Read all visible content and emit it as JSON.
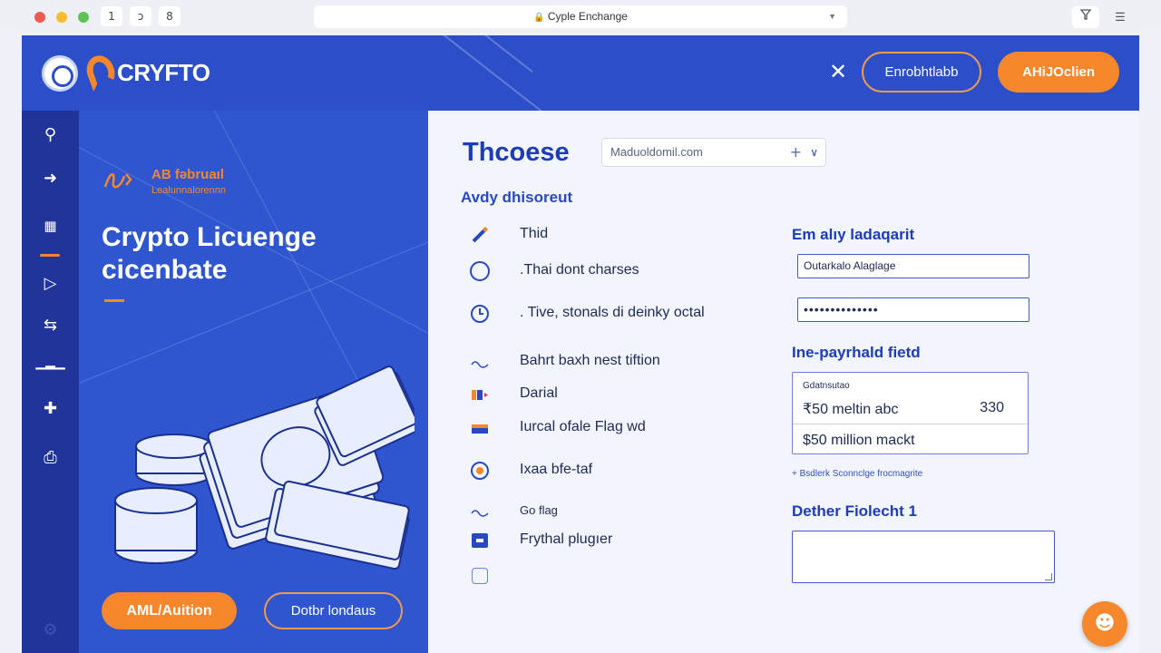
{
  "browser": {
    "tab_title": "Cyple Enchange",
    "nav": [
      "1",
      "ↄ",
      "8"
    ],
    "right_icons": [
      "filter-icon",
      "menu-icon"
    ]
  },
  "header": {
    "brand": "CRYFTO",
    "outline_button": "Enrobhtlabb",
    "primary_button": "AHiJOclien",
    "colors": {
      "brand_blue": "#2c4fc9",
      "accent_orange": "#f7872c"
    }
  },
  "sidebar": {
    "icons": [
      "location-icon",
      "arrow-icon",
      "building-icon",
      "play-icon",
      "exchange-icon",
      "chart-icon",
      "plus-icon",
      "printer-icon",
      "settings-icon"
    ]
  },
  "hero": {
    "tag_line1": "AB fəbruaıl",
    "tag_line2": "Lealunnalorennn",
    "title": "Crypto Licuenge cicenbate",
    "button_primary": "AML/Auition",
    "button_secondary": "Dotbr londaus"
  },
  "form": {
    "title": "Thcoese",
    "select_value": "Maduoldomil.com",
    "subheading": "Avdy dhisoreut",
    "options": [
      {
        "label": "Thid",
        "icon": "pen-icon"
      },
      {
        "label": ".Thai dont charses",
        "icon": "circle-icon"
      },
      {
        "label": ". Tive, stonals di deinky octal",
        "icon": "clock-icon"
      },
      {
        "label": "Bahrt baxh nest tiftion",
        "icon": "wave-icon"
      },
      {
        "label": "Darial",
        "icon": "flag-icon"
      },
      {
        "label": "Iurcal ofale Flag wd",
        "icon": "flag-icon"
      },
      {
        "label": "Ixaa bfe-taf",
        "icon": "globe-icon"
      },
      {
        "label": "Go flag",
        "icon": "wave-icon"
      },
      {
        "label": "Frythal plugıer",
        "icon": "square-icon"
      },
      {
        "label": "",
        "icon": "square-outline-icon"
      }
    ],
    "right": {
      "heading1": "Em alıy ladaqarit",
      "field1_value": "Outarkalo Alaglage",
      "field2_value": "••••••••••••••",
      "heading2": "Ine-payrhald fietd",
      "box_label": "Gdatnsutao",
      "box_line1": "₹50 meltin abc",
      "box_line1_value": "330",
      "box_line2": "$50 million mackt",
      "hint": "+ Bsdlerk Sconnclge frocmagrite",
      "heading3": "Dether Fiolecht 1",
      "textarea_value": ""
    }
  },
  "fab_icon": "chat-icon"
}
